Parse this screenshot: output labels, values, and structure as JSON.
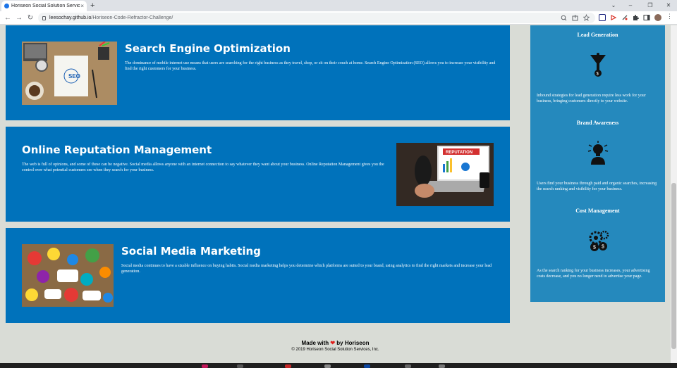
{
  "browser": {
    "tab_title": "Horiseon Social Solution Services",
    "tab_close": "×",
    "new_tab": "+",
    "url_domain": "leesochay.github.io",
    "url_path": "/Horiseon-Code-Refractor-Challenge/",
    "back": "←",
    "forward": "→",
    "reload": "↻",
    "minimize": "⌄",
    "restore": "–",
    "maximize": "❐",
    "close": "✕"
  },
  "sections": [
    {
      "heading": "Search Engine Optimization",
      "text": "The dominance of mobile internet use means that users are searching for the right business as they travel, shop, or sit on their couch at home. Search Engine Optimization (SEO) allows you to increase your visibility and find the right customers for your business.",
      "image_label": "SEO"
    },
    {
      "heading": "Online Reputation Management",
      "text": "The web is full of opinions, and some of these can be negative. Social media allows anyone with an internet connection to say whatever they want about your business. Online Reputation Management gives you the control over what potential customers see when they search for your business.",
      "image_label": "REPUTATION"
    },
    {
      "heading": "Social Media Marketing",
      "text": "Social media continues to have a sizable influence on buying habits. Social media marketing helps you determine which platforms are suited to your brand, using analytics to find the right markets and increase your lead generation."
    }
  ],
  "benefits": [
    {
      "heading": "Lead Generation",
      "icon": "funnel-dollar-icon",
      "text": "Inbound strategies for lead generation require less work for your business, bringing customers directly to your website."
    },
    {
      "heading": "Brand Awareness",
      "icon": "lightbulb-person-icon",
      "text": "Users find your business through paid and organic searches, increasing the search ranking and visibility for your business."
    },
    {
      "heading": "Cost Management",
      "icon": "gears-dollar-icon",
      "text": "As the search ranking for your business increases, your advertising costs decrease, and you no longer need to advertise your page."
    }
  ],
  "footer": {
    "made_with": "Made with",
    "heart": "❤",
    "by": "by Horiseon",
    "copyright": "© 2019 Horiseon Social Solution Services, Inc."
  },
  "colors": {
    "card_blue": "#0072bb",
    "sidebar_blue": "#2589bd",
    "page_bg": "#d9dcd6",
    "heart": "#e0201c"
  }
}
